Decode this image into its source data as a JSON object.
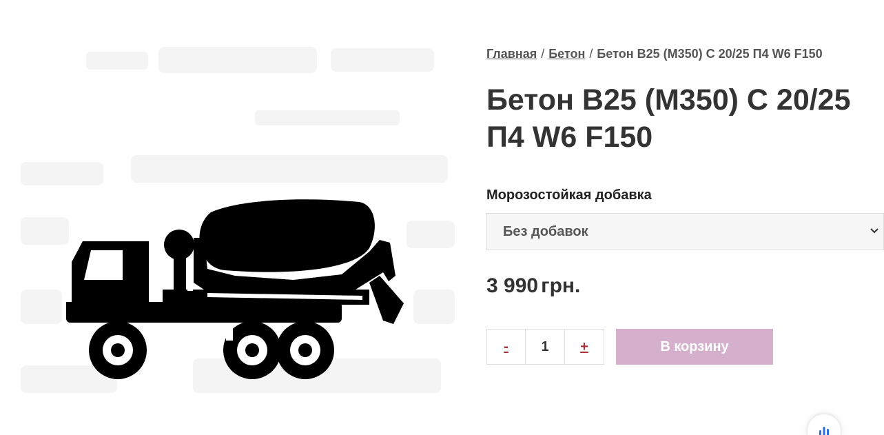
{
  "breadcrumb": {
    "home": "Главная",
    "category": "Бетон",
    "current": "Бетон В25 (М350) С 20/25 П4 W6 F150",
    "separator": "/"
  },
  "product": {
    "title": "Бетон В25 (М350) С 20/25 П4 W6 F150",
    "image_icon": "concrete-mixer-truck-icon"
  },
  "options": {
    "label": "Морозостойкая добавка",
    "selected": "Без добавок"
  },
  "price": {
    "amount": "3 990",
    "currency": "грн."
  },
  "quantity": {
    "minus": "-",
    "value": "1",
    "plus": "+"
  },
  "cart": {
    "button_label": "В корзину"
  },
  "colors": {
    "cart_button": "#d5b0cd",
    "qty_buttons": "#a8323a",
    "widget_icon": "#2b6fe0"
  }
}
